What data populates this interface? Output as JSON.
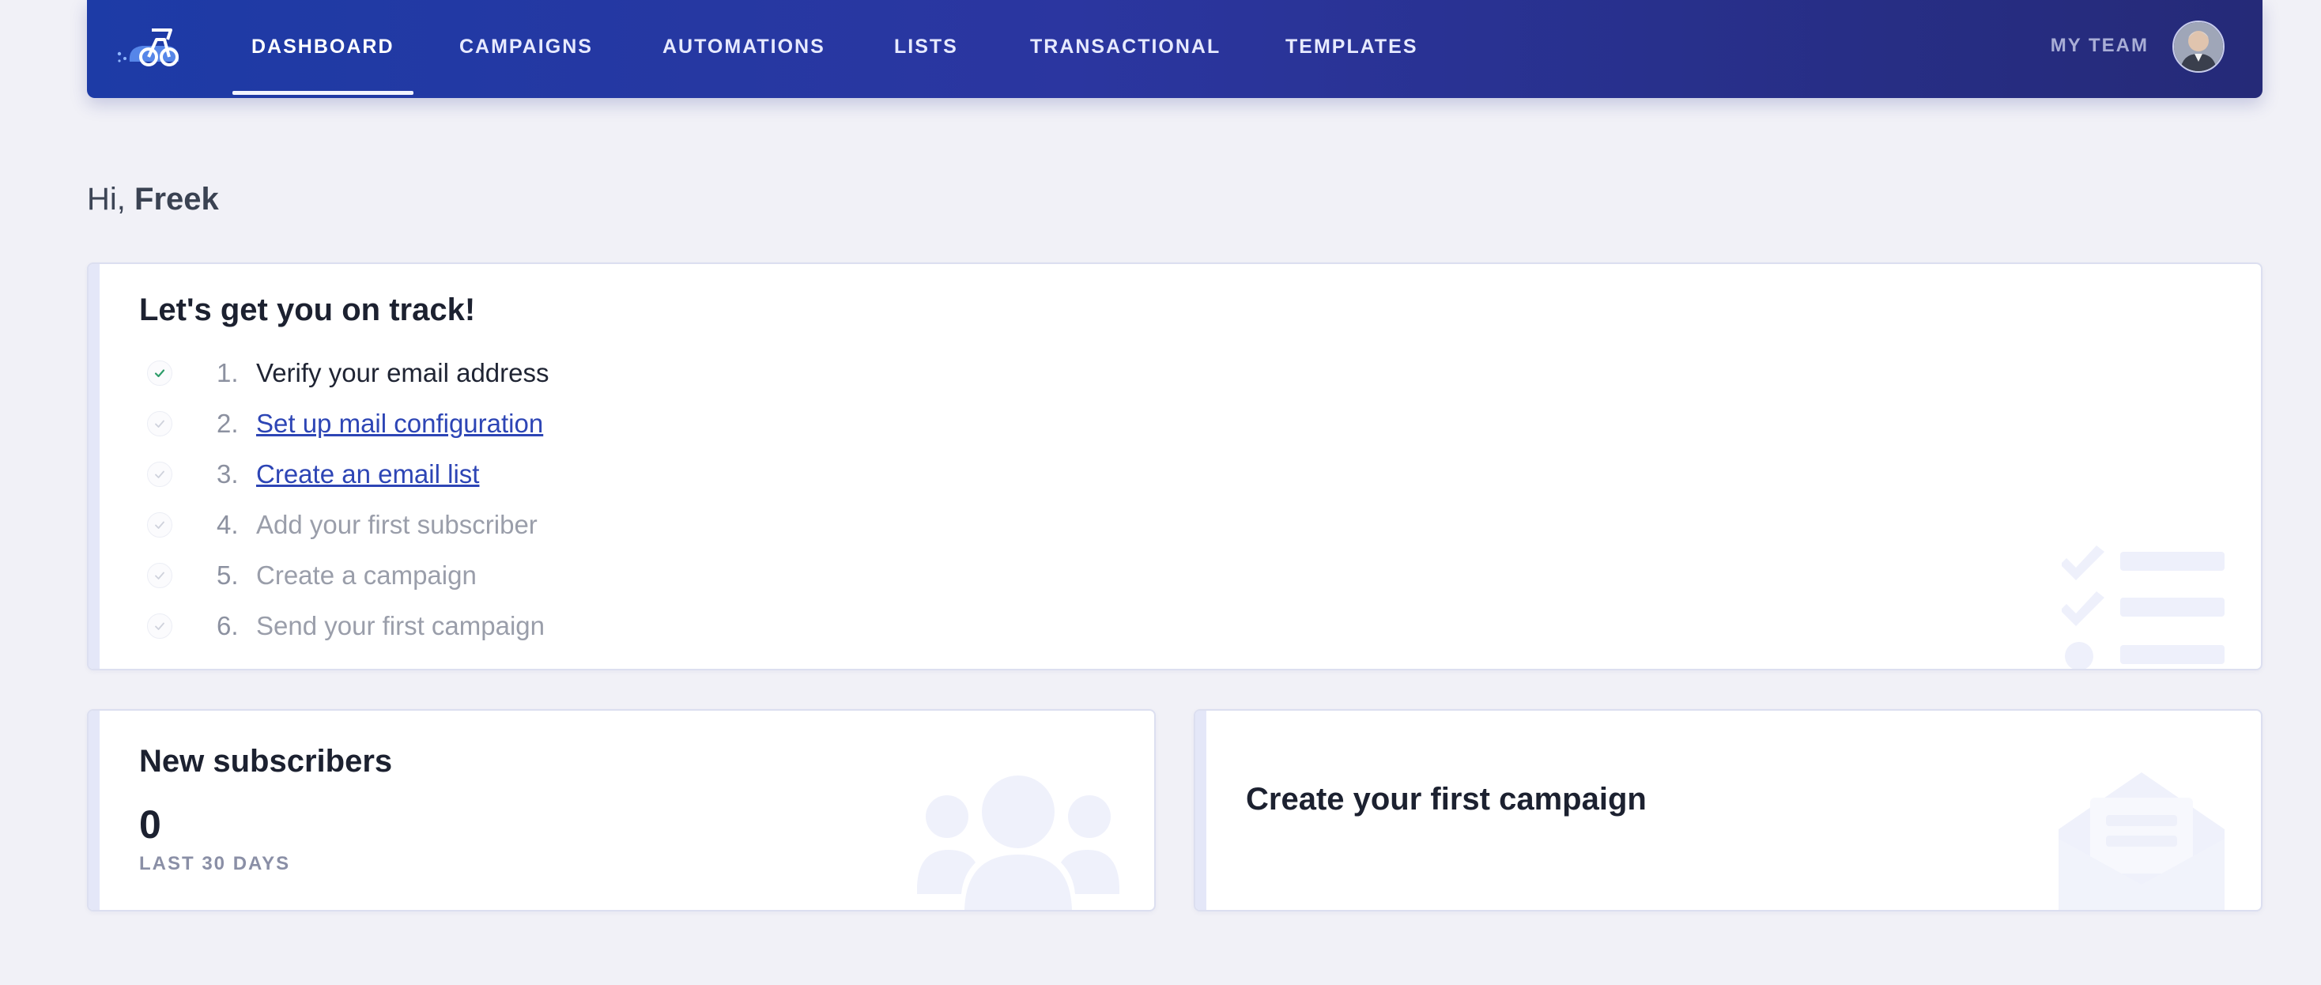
{
  "nav": {
    "items": [
      {
        "label": "DASHBOARD",
        "active": true
      },
      {
        "label": "CAMPAIGNS",
        "active": false
      },
      {
        "label": "AUTOMATIONS",
        "active": false
      },
      {
        "label": "LISTS",
        "active": false
      },
      {
        "label": "TRANSACTIONAL",
        "active": false
      },
      {
        "label": "TEMPLATES",
        "active": false
      }
    ],
    "team_label": "MY TEAM",
    "logo_icon": "bike-rider-icon",
    "avatar_icon": "user-avatar"
  },
  "greeting": {
    "prefix": "Hi,",
    "name": "Freek"
  },
  "onboarding": {
    "title": "Let's get you on track!",
    "steps": [
      {
        "number": "1.",
        "label": "Verify your email address",
        "done": true,
        "link": false
      },
      {
        "number": "2.",
        "label": "Set up mail configuration",
        "done": false,
        "link": true
      },
      {
        "number": "3.",
        "label": "Create an email list",
        "done": false,
        "link": true
      },
      {
        "number": "4.",
        "label": "Add your first subscriber",
        "done": false,
        "link": false
      },
      {
        "number": "5.",
        "label": "Create a campaign",
        "done": false,
        "link": false
      },
      {
        "number": "6.",
        "label": "Send your first campaign",
        "done": false,
        "link": false
      }
    ]
  },
  "new_subscribers": {
    "title": "New subscribers",
    "count": "0",
    "period": "LAST 30 DAYS"
  },
  "campaign_card": {
    "title": "Create your first campaign"
  },
  "colors": {
    "nav_start": "#1d3ba6",
    "nav_end": "#252a78",
    "link": "#2d45b5",
    "check_done": "#2e9d6a",
    "check_todo": "#cfd2dc",
    "background": "#f1f1f7"
  }
}
